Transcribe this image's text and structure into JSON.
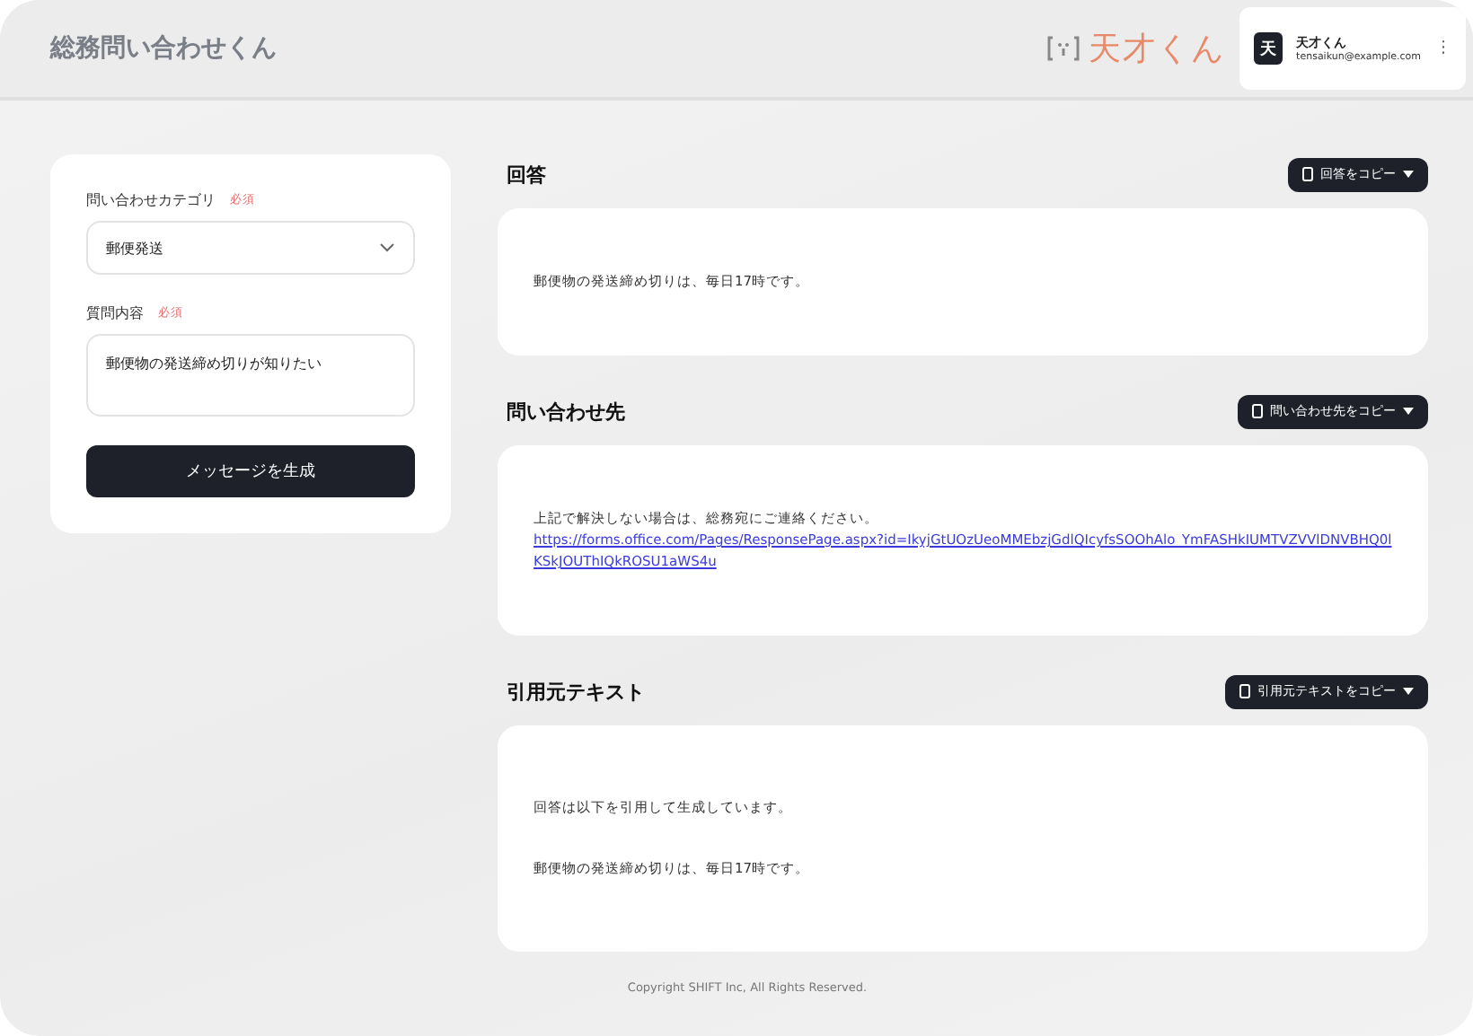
{
  "header": {
    "title": "総務問い合わせくん",
    "logo_text": "天才くん",
    "user": {
      "avatar": "天",
      "name": "天才くん",
      "email": "tensaikun@example.com",
      "menu": "⋮"
    }
  },
  "form": {
    "category": {
      "label": "問い合わせカテゴリ",
      "required": "必須",
      "value": "郵便発送"
    },
    "question": {
      "label": "質問内容",
      "required": "必須",
      "value": "郵便物の発送締め切りが知りたい"
    },
    "submit": "メッセージを生成"
  },
  "sections": [
    {
      "title": "回答",
      "copy_button": "回答をコピー",
      "paragraphs": [
        {
          "kind": "text",
          "text": "郵便物の発送締め切りは、毎日17時です。"
        }
      ]
    },
    {
      "title": "問い合わせ先",
      "copy_button": "問い合わせ先をコピー",
      "paragraphs": [
        {
          "kind": "text",
          "text": "上記で解決しない場合は、総務宛にご連絡ください。"
        },
        {
          "kind": "link",
          "text": "https://forms.office.com/Pages/ResponsePage.aspx?id=IkyjGtUOzUeoMMEbzjGdlQIcyfsSOOhAlo_YmFASHkIUMTVZVVlDNVBHQ0lKSkJOUThIQkROSU1aWS4u"
        }
      ]
    },
    {
      "title": "引用元テキスト",
      "copy_button": "引用元テキストをコピー",
      "paragraphs": [
        {
          "kind": "text",
          "text": "回答は以下を引用して生成しています。"
        },
        {
          "kind": "gap"
        },
        {
          "kind": "text",
          "text": "郵便物の発送締め切りは、毎日17時です。"
        }
      ]
    }
  ],
  "footer": "Copyright SHIFT Inc, All Rights Reserved."
}
